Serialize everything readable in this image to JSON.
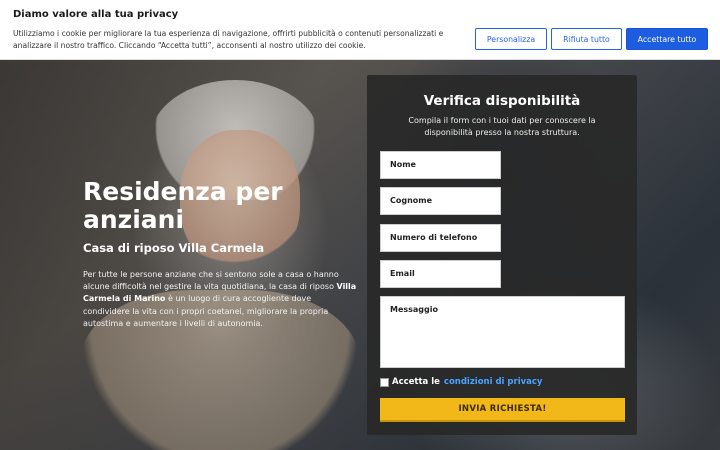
{
  "cookie": {
    "title": "Diamo valore alla tua privacy",
    "text": "Utilizziamo i cookie per migliorare la tua esperienza di navigazione, offrirti pubblicità o contenuti personalizzati e analizzare il nostro traffico. Cliccando “Accetta tutti”, acconsenti al nostro utilizzo dei cookie.",
    "customize_label": "Personalizza",
    "reject_label": "Rifiuta tutto",
    "accept_label": "Accettare tutto",
    "accent_color": "#1d5ee0"
  },
  "hero": {
    "title": "Residenza per anziani",
    "subtitle": "Casa di riposo Villa Carmela",
    "desc_part1": "Per tutte le persone anziane che si sentono sole a casa o hanno alcune difficoltà nel gestire la vita quotidiana, la casa di riposo ",
    "desc_bold": "Villa Carmela di Marino",
    "desc_part2": " è un luogo di cura accogliente dove condividere la vita con i propri coetanei, migliorare la propria autostima e aumentare i livelli di autonomia."
  },
  "form": {
    "title": "Verifica disponibilità",
    "description": "Compila il form con i tuoi dati per conoscere la disponibilità presso la nostra struttura.",
    "fields": {
      "name": "Nome",
      "surname": "Cognome",
      "phone": "Numero di telefono",
      "email": "Email",
      "message": "Messaggio"
    },
    "privacy_prefix": "Accetta le",
    "privacy_link": "condizioni di privacy",
    "submit_label": "INVIA RICHIESTA!",
    "submit_color": "#f2b81a"
  }
}
